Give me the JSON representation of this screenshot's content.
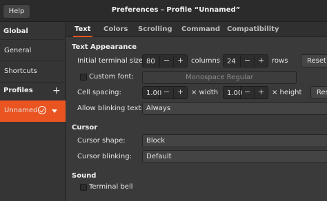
{
  "header": {
    "help_label": "Help",
    "title": "Preferences – Profile “Unnamed”"
  },
  "sidebar": {
    "global_heading": "Global",
    "items": [
      {
        "label": "General"
      },
      {
        "label": "Shortcuts"
      }
    ],
    "profiles_heading": "Profiles",
    "add_symbol": "+",
    "selected_profile": "Unnamed"
  },
  "tabs": [
    {
      "label": "Text",
      "active": true
    },
    {
      "label": "Colors"
    },
    {
      "label": "Scrolling"
    },
    {
      "label": "Command"
    },
    {
      "label": "Compatibility"
    }
  ],
  "text_appearance": {
    "heading": "Text Appearance",
    "terminal_size_label": "Initial terminal size:",
    "columns_value": "80",
    "columns_label": "columns",
    "rows_value": "24",
    "rows_label": "rows",
    "reset_label": "Reset",
    "custom_font_label": "Custom font:",
    "font_value": "Monospace Regular",
    "cell_spacing_label": "Cell spacing:",
    "width_value": "1.00",
    "width_label": "× width",
    "height_value": "1.00",
    "height_label": "× height",
    "allow_blink_label": "Allow blinking text:",
    "allow_blink_value": "Always"
  },
  "cursor": {
    "heading": "Cursor",
    "shape_label": "Cursor shape:",
    "shape_value": "Block",
    "blinking_label": "Cursor blinking:",
    "blinking_value": "Default"
  },
  "sound": {
    "heading": "Sound",
    "bell_label": "Terminal bell"
  },
  "spin_minus": "−",
  "spin_plus": "+",
  "colors": {
    "accent": "#e95420"
  }
}
